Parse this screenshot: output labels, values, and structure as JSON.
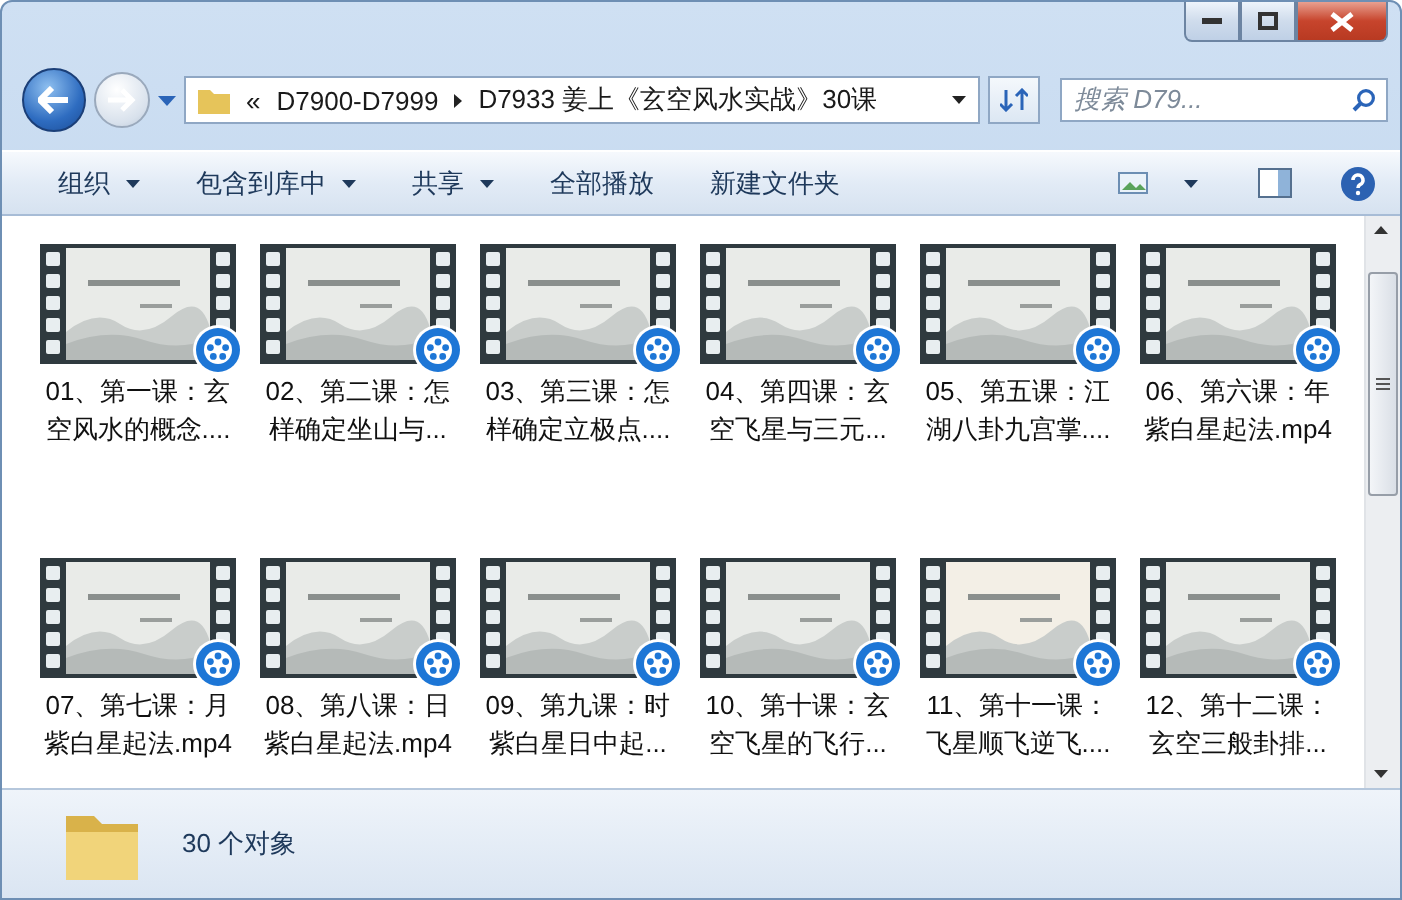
{
  "address": {
    "prefix": "«",
    "segments": [
      "D7900-D7999",
      "D7933 姜上《玄空风水实战》30课"
    ]
  },
  "search": {
    "placeholder": "搜索 D79..."
  },
  "toolbar": [
    {
      "label": "组织",
      "dropdown": true
    },
    {
      "label": "包含到库中",
      "dropdown": true
    },
    {
      "label": "共享",
      "dropdown": true
    },
    {
      "label": "全部播放",
      "dropdown": false
    },
    {
      "label": "新建文件夹",
      "dropdown": false
    }
  ],
  "files": [
    {
      "kind": "video",
      "lines": [
        "01、第一课：玄",
        "空风水的概念...."
      ]
    },
    {
      "kind": "video",
      "lines": [
        "02、第二课：怎",
        "样确定坐山与..."
      ]
    },
    {
      "kind": "video",
      "lines": [
        "03、第三课：怎",
        "样确定立极点...."
      ]
    },
    {
      "kind": "video",
      "lines": [
        "04、第四课：玄",
        "空飞星与三元..."
      ]
    },
    {
      "kind": "video",
      "lines": [
        "05、第五课：江",
        "湖八卦九宫掌...."
      ]
    },
    {
      "kind": "video",
      "lines": [
        "06、第六课：年",
        "紫白星起法.mp4"
      ]
    },
    {
      "kind": "video",
      "lines": [
        "07、第七课：月",
        "紫白星起法.mp4"
      ]
    },
    {
      "kind": "video",
      "lines": [
        "08、第八课：日",
        "紫白星起法.mp4"
      ]
    },
    {
      "kind": "video",
      "lines": [
        "09、第九课：时",
        "紫白星日中起..."
      ]
    },
    {
      "kind": "video",
      "lines": [
        "10、第十课：玄",
        "空飞星的飞行..."
      ]
    },
    {
      "kind": "video",
      "lines": [
        "11、第十一课：",
        "飞星顺飞逆飞...."
      ]
    },
    {
      "kind": "video",
      "lines": [
        "12、第十二课：",
        "玄空三般卦排..."
      ]
    }
  ],
  "status": {
    "count": "30 个对象"
  }
}
